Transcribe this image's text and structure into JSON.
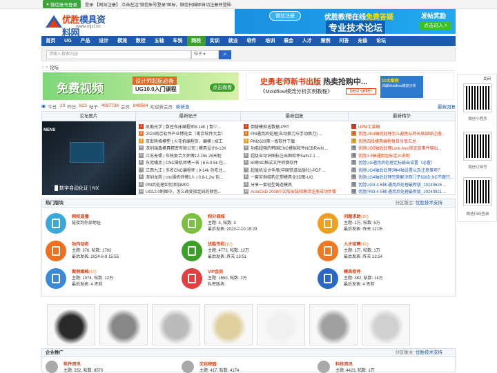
{
  "topbar": {
    "wx_login": "微信账号登录",
    "text": "登录 【网站注册】 点击左边\"微信账号登录\"图标，微信扫描即自动注册并登陆"
  },
  "logo": {
    "text_a": "优胜",
    "text_b": "模具资料网",
    "url": "www.mjzl.cn"
  },
  "header_banner": {
    "reg": "微信注册",
    "text1a": "优胜教师在线",
    "text1b": "免费答疑",
    "text2": "专业技术论坛",
    "post": "发帖奖励",
    "click": "点击进入 >"
  },
  "nav": [
    "首页",
    "UG",
    "产品",
    "设计",
    "模流",
    "数控",
    "五轴",
    "车铣",
    "网校",
    "实训",
    "就业",
    "软件",
    "培训",
    "展会",
    "人才",
    "案例",
    "问答",
    "充值",
    "论坛"
  ],
  "search": {
    "placeholder": "请输入搜索内容",
    "scope": "帖子"
  },
  "breadcrumb": {
    "sep": "›",
    "item": "论坛"
  },
  "ad1": {
    "title": "免费视频",
    "tag": "设计师起航必备",
    "tag2": "UG10.0入门课程",
    "btn": "点击观看"
  },
  "ad2": {
    "title_a": "史勇老师新书出版",
    "title_b": "热卖抢购中...",
    "sub": "《Moldflow模流分析实例教程》",
    "btn": "best seller",
    "box_a": "10大案例",
    "box_b": "详解Moldflow模流分析"
  },
  "stats": {
    "today_l": "今日:",
    "today": "20",
    "yesterday_l": "昨日:",
    "yesterday": "823",
    "posts_l": "帖子:",
    "posts": "4097738",
    "members_l": "会员:",
    "members": "848564",
    "welcome": "欢迎新会员:",
    "new_member": "新新渔",
    "right": "最新回复"
  },
  "grid": {
    "h1": "论坛图片",
    "h2": "最新帖子",
    "h3": "最新回复",
    "h4": "最新精华",
    "pic_tag": "MENS",
    "pic_caption": "█ 数字自动化证 | NX",
    "col1": [
      "凯融光学 | 数控车床编程师8-14K | 青少...",
      "2024南京软件产业博览会（南京软件大会）",
      "厚街耗格模塑 | 火花机编程员，编模 | 招工",
      "深圳瑞鑫模具精密有限公司 | 模具设计8-12K",
      "江苏无锡 | 车铣复合大师傅12-15k 26天制",
      "东莞横沥 | CNC操机师傅一名 | 8.5-9.5k 包...",
      "江西九江 | 多名CNC编程师 | 9-14k 包吃住...",
      "深圳龙岗 | cnc操机师傅1人 | 0.8-1.2w 包...",
      "PM后处理如何添加M00",
      "UG12.0制图中，怎么改变指定线的颜色..."
    ],
    "col2": [
      "倒拔模抑送数据-PRT",
      "PM通用后处理(自动换刀与手动换刀) ...",
      "PM2020第一板软件下载",
      "功能超强的韩国CNC模拟软件NCBRAIN ...",
      "超级自动识图标注出图软件Saltv2.1 ...",
      "80种3D格式文件转换软件",
      "超值机设计手册(中国铁道出版社)-PDF ...",
      "一套实例结构注塑模具全3D图-UG",
      "分享一套轻型铸造模具",
      "AutoCAD 2008中文版安装和激活注册成功步骤"
    ],
    "col3": [
      "UPM工装箱",
      "优胜UG4轴后处理怎么避免从转长底部穿过撞...",
      "优胜四段模具编程每日分享汇总",
      "优胜UG5轴后处理Lock Axis锁定旋事件输出...",
      "优胜4-5轴通用坐标定义说明",
      "优胜UG通用后处理定标输出设置（必看）",
      "优胜UG4轴后处理3种4轴设置以及注意事项？",
      "优胜UG4轴后处理完美解决西门子828D NC不跟行...",
      "优胜UG3-4-5轴-通用后处理最新版_20240625 ...",
      "优胜PM3-4-5轴-通用后处理最新版_20240921 ..."
    ]
  },
  "hot": {
    "title": "热门版块",
    "right_a": "分区版主:",
    "right_b": "优胜技术支持",
    "forums": [
      {
        "name": "网校直播",
        "count": "",
        "l1": "链接到外部地址",
        "l2": ""
      },
      {
        "name": "积分商城",
        "count": "",
        "l1": "主题: 3, 帖数: 3",
        "l2": "最后发表: 2023-2-10 15:29"
      },
      {
        "name": "问题求助",
        "count": "(10)",
        "l1": "主题: 1万, 帖数: 5万",
        "l2": "最后发表: 昨天 12:05"
      },
      {
        "name": "站内动态",
        "count": "",
        "l1": "主题: 376, 帖数: 1792",
        "l2": "最后发表: 2024-6-9 15:55"
      },
      {
        "name": "优胜专栏",
        "count": "(10)",
        "l1": "主题: 4773, 帖数: 12万",
        "l2": "最后发表: 昨天 13:51"
      },
      {
        "name": "人才招聘",
        "count": "(10)",
        "l1": "主题: 1万, 帖数: 1万",
        "l2": "最后发表: 昨天 13:24"
      },
      {
        "name": "案例图档",
        "count": "(10)",
        "l1": "主题: 1074, 帖数: 12万",
        "l2": "最后发表: 4 天前"
      },
      {
        "name": "VIP会员",
        "count": "",
        "l1": "主题: 1550, 帖数: 2万",
        "l2": "私密版块"
      },
      {
        "name": "模具软件",
        "count": "",
        "l1": "主题: 382, 帖数: 14万",
        "l2": "最后发表: 4 天前"
      }
    ]
  },
  "ent": {
    "title": "企业推广",
    "right_a": "分区版主:",
    "right_b": "优胜技术支持",
    "items": [
      {
        "name": "软件资讯",
        "l1": "主题: 252, 帖数: 8570"
      },
      {
        "name": "文化校园",
        "l1": "主题: 417, 帖数: 4174"
      },
      {
        "name": "科技资讯",
        "l1": "主题: 4423, 帖数: 1万"
      }
    ]
  },
  "side": {
    "q1": "微信小程序",
    "q2": "微信订阅号",
    "q3": "微信扫码登录",
    "x": "关闭"
  },
  "colors": {
    "nav": "#1e5bb0",
    "accent": "#e03a0a",
    "green": "#3aa02a"
  }
}
